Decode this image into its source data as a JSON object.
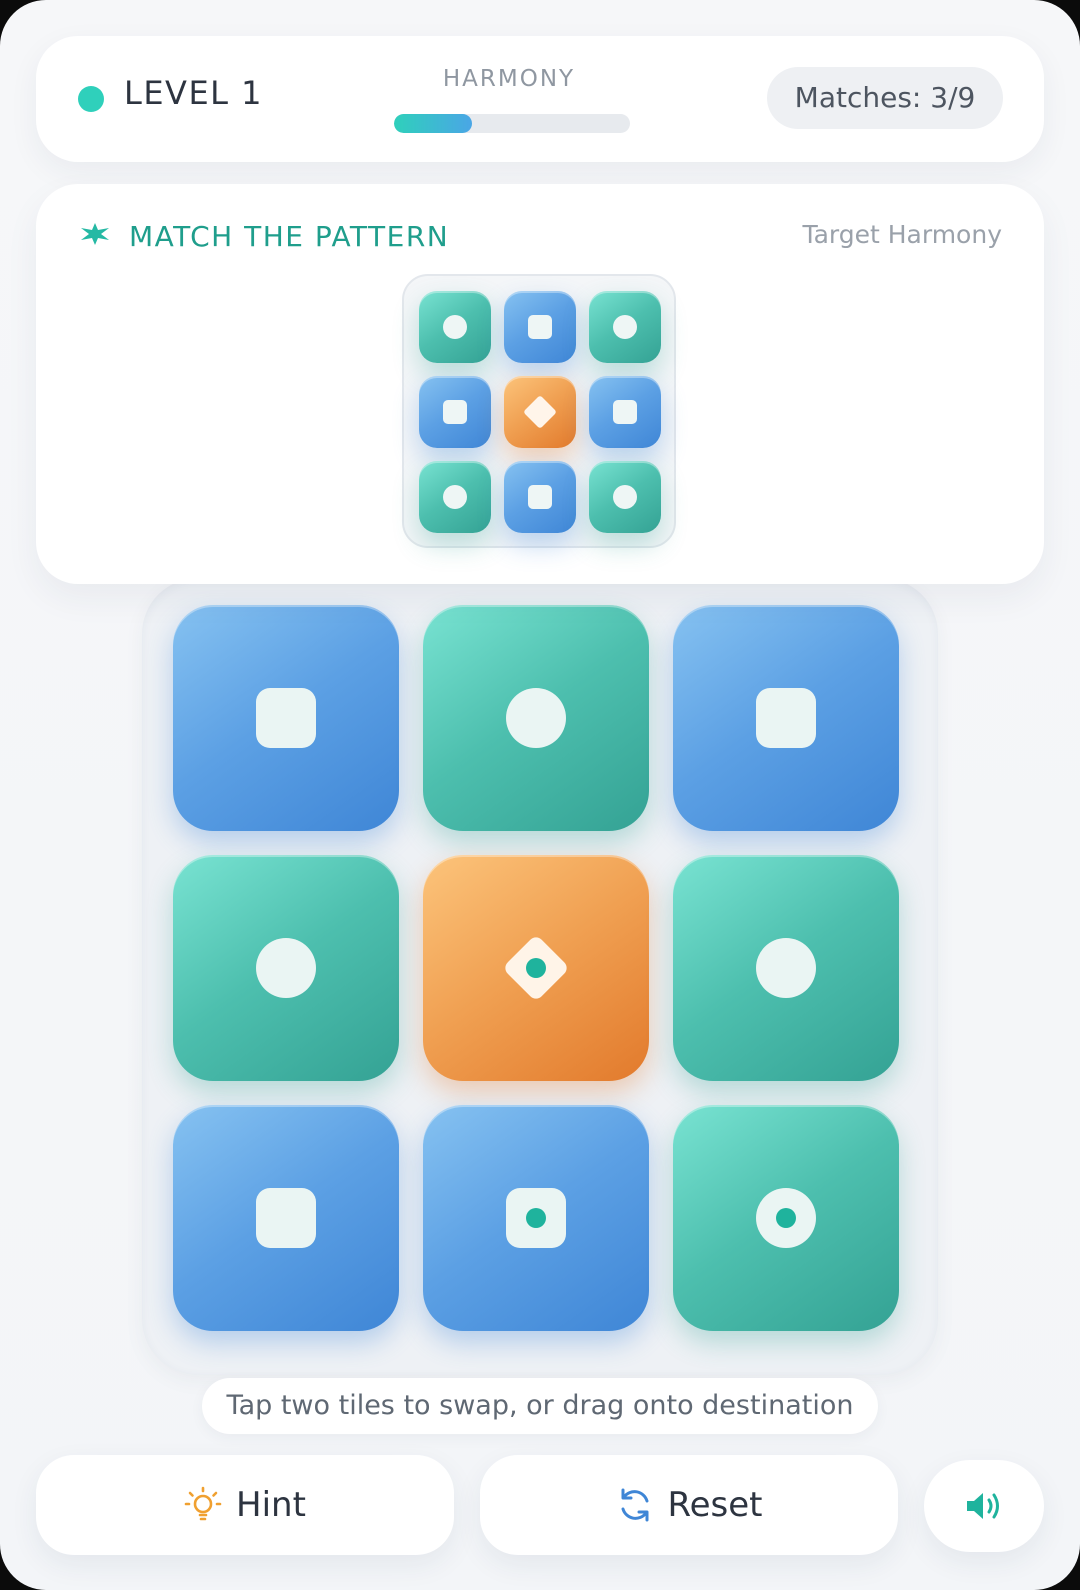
{
  "header": {
    "level": "LEVEL 1",
    "harmony_label": "HARMONY",
    "harmony_progress": 0.33,
    "matches": "Matches: 3/9"
  },
  "target": {
    "title": "MATCH THE PATTERN",
    "subtitle": "Target Harmony",
    "grid": [
      {
        "color": "teal",
        "shape": "circle"
      },
      {
        "color": "blue",
        "shape": "square"
      },
      {
        "color": "teal",
        "shape": "circle"
      },
      {
        "color": "blue",
        "shape": "square"
      },
      {
        "color": "orange",
        "shape": "diamond"
      },
      {
        "color": "blue",
        "shape": "square"
      },
      {
        "color": "teal",
        "shape": "circle"
      },
      {
        "color": "blue",
        "shape": "square"
      },
      {
        "color": "teal",
        "shape": "circle"
      }
    ]
  },
  "board": {
    "tiles": [
      {
        "color": "blue",
        "shape": "square",
        "dot": false
      },
      {
        "color": "teal",
        "shape": "circle",
        "dot": false
      },
      {
        "color": "blue",
        "shape": "square",
        "dot": false
      },
      {
        "color": "teal",
        "shape": "circle",
        "dot": false
      },
      {
        "color": "orange",
        "shape": "diamond",
        "dot": true
      },
      {
        "color": "teal",
        "shape": "circle",
        "dot": false
      },
      {
        "color": "blue",
        "shape": "square",
        "dot": false
      },
      {
        "color": "blue",
        "shape": "square",
        "dot": true
      },
      {
        "color": "teal",
        "shape": "circle",
        "dot": true
      }
    ]
  },
  "instruction": "Tap two tiles to swap, or drag onto destination",
  "controls": {
    "hint_label": "Hint",
    "hint_icon": "lightbulb-icon",
    "reset_label": "Reset",
    "reset_icon": "refresh-icon",
    "sound_icon": "speaker-icon"
  },
  "colors": {
    "teal": "#2fd0bb",
    "title_teal": "#1f9e8c",
    "blue": "#4a94dd",
    "orange": "#ee9440"
  }
}
